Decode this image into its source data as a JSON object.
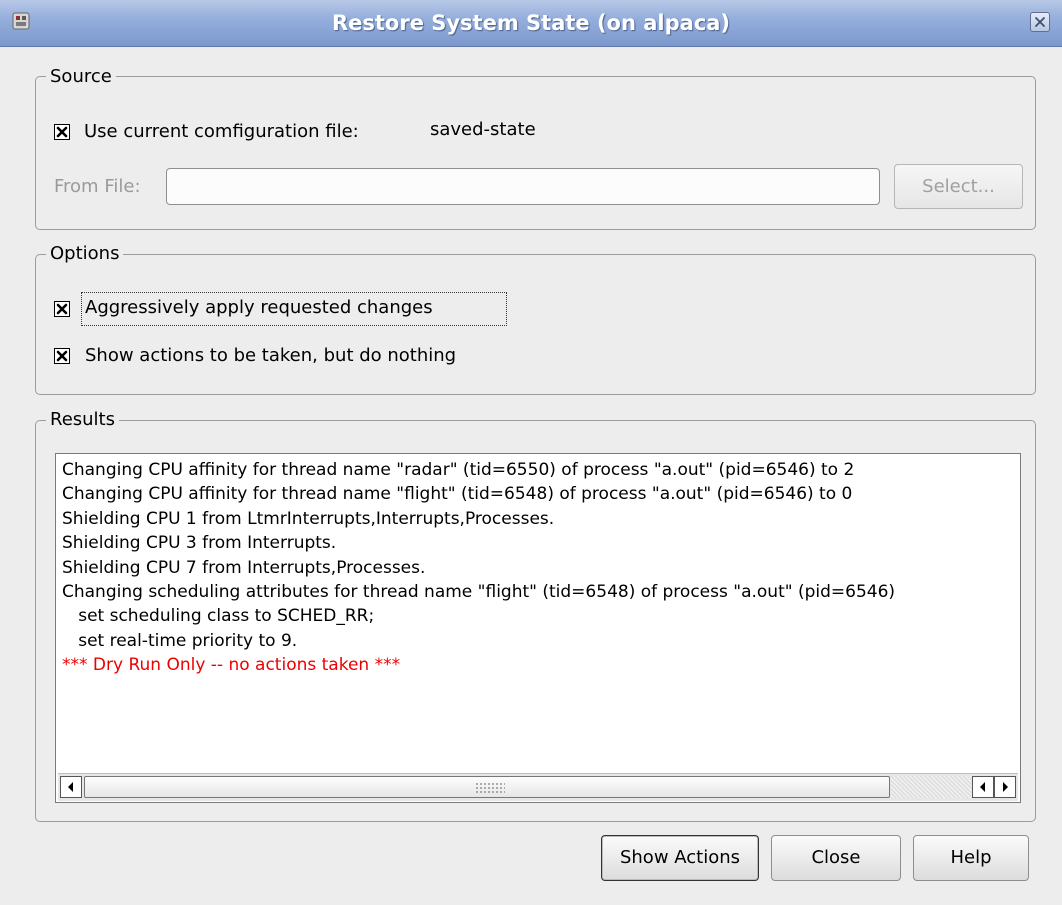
{
  "window": {
    "title": "Restore System State (on alpaca)"
  },
  "source": {
    "legend": "Source",
    "use_current_label": "Use current comfiguration file:",
    "use_current_checked": true,
    "config_file_value": "saved-state",
    "from_file_label": "From File:",
    "from_file_value": "",
    "select_button": "Select..."
  },
  "options": {
    "legend": "Options",
    "aggressive_label": "Aggressively apply requested changes",
    "aggressive_checked": true,
    "dry_run_label": "Show actions to be taken, but do nothing",
    "dry_run_checked": true
  },
  "results": {
    "legend": "Results",
    "lines": [
      {
        "text": "Changing CPU affinity for thread name \"radar\" (tid=6550) of process \"a.out\" (pid=6546) to 2",
        "color": "#000000"
      },
      {
        "text": "Changing CPU affinity for thread name \"flight\" (tid=6548) of process \"a.out\" (pid=6546) to 0",
        "color": "#000000"
      },
      {
        "text": "Shielding CPU 1 from LtmrInterrupts,Interrupts,Processes.",
        "color": "#000000"
      },
      {
        "text": "Shielding CPU 3 from Interrupts.",
        "color": "#000000"
      },
      {
        "text": "Shielding CPU 7 from Interrupts,Processes.",
        "color": "#000000"
      },
      {
        "text": "Changing scheduling attributes for thread name \"flight\" (tid=6548) of process \"a.out\" (pid=6546)",
        "color": "#000000"
      },
      {
        "text": "   set scheduling class to SCHED_RR;",
        "color": "#000000"
      },
      {
        "text": "   set real-time priority to 9.",
        "color": "#000000"
      },
      {
        "text": "*** Dry Run Only -- no actions taken ***",
        "color": "#ee0000"
      }
    ]
  },
  "buttons": {
    "show_actions": "Show Actions",
    "close": "Close",
    "help": "Help"
  }
}
